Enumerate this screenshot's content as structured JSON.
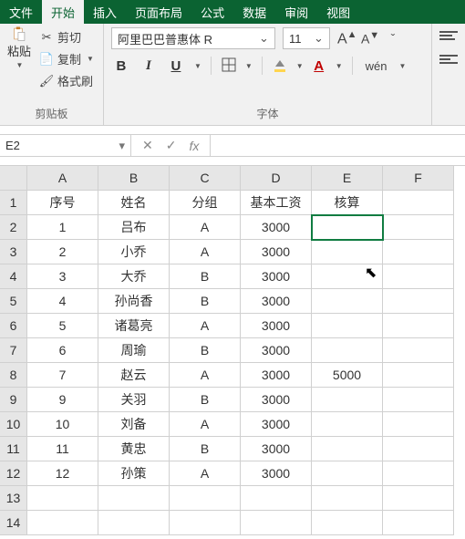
{
  "tabs": {
    "file": "文件",
    "home": "开始",
    "insert": "插入",
    "layout": "页面布局",
    "formula": "公式",
    "data": "数据",
    "review": "审阅",
    "view": "视图"
  },
  "clipboard": {
    "paste": "粘贴",
    "cut": "剪切",
    "copy": "复制",
    "format": "格式刷",
    "group_label": "剪贴板"
  },
  "font": {
    "name": "阿里巴巴普惠体 R",
    "size": "11",
    "bold": "B",
    "italic": "I",
    "underline": "U",
    "wen": "wén",
    "group_label": "字体"
  },
  "namebox": "E2",
  "formula_value": "",
  "columns": [
    "A",
    "B",
    "C",
    "D",
    "E",
    "F"
  ],
  "headers": [
    "序号",
    "姓名",
    "分组",
    "基本工资",
    "核算",
    ""
  ],
  "rows": [
    {
      "n": "1",
      "a": "1",
      "b": "吕布",
      "c": "A",
      "d": "3000",
      "e": "",
      "f": ""
    },
    {
      "n": "2",
      "a": "2",
      "b": "小乔",
      "c": "A",
      "d": "3000",
      "e": "",
      "f": ""
    },
    {
      "n": "3",
      "a": "3",
      "b": "大乔",
      "c": "B",
      "d": "3000",
      "e": "",
      "f": ""
    },
    {
      "n": "4",
      "a": "4",
      "b": "孙尚香",
      "c": "B",
      "d": "3000",
      "e": "",
      "f": ""
    },
    {
      "n": "5",
      "a": "5",
      "b": "诸葛亮",
      "c": "A",
      "d": "3000",
      "e": "",
      "f": ""
    },
    {
      "n": "6",
      "a": "6",
      "b": "周瑜",
      "c": "B",
      "d": "3000",
      "e": "",
      "f": ""
    },
    {
      "n": "7",
      "a": "7",
      "b": "赵云",
      "c": "A",
      "d": "3000",
      "e": "5000",
      "f": ""
    },
    {
      "n": "8",
      "a": "9",
      "b": "关羽",
      "c": "B",
      "d": "3000",
      "e": "",
      "f": ""
    },
    {
      "n": "9",
      "a": "10",
      "b": "刘备",
      "c": "A",
      "d": "3000",
      "e": "",
      "f": ""
    },
    {
      "n": "10",
      "a": "11",
      "b": "黄忠",
      "c": "B",
      "d": "3000",
      "e": "",
      "f": ""
    },
    {
      "n": "11",
      "a": "12",
      "b": "孙策",
      "c": "A",
      "d": "3000",
      "e": "",
      "f": ""
    },
    {
      "n": "12",
      "a": "",
      "b": "",
      "c": "",
      "d": "",
      "e": "",
      "f": ""
    },
    {
      "n": "13",
      "a": "",
      "b": "",
      "c": "",
      "d": "",
      "e": "",
      "f": ""
    }
  ],
  "chart_data": {
    "type": "table",
    "columns": [
      "序号",
      "姓名",
      "分组",
      "基本工资",
      "核算"
    ],
    "rows": [
      [
        1,
        "吕布",
        "A",
        3000,
        null
      ],
      [
        2,
        "小乔",
        "A",
        3000,
        null
      ],
      [
        3,
        "大乔",
        "B",
        3000,
        null
      ],
      [
        4,
        "孙尚香",
        "B",
        3000,
        null
      ],
      [
        5,
        "诸葛亮",
        "A",
        3000,
        null
      ],
      [
        6,
        "周瑜",
        "B",
        3000,
        null
      ],
      [
        7,
        "赵云",
        "A",
        3000,
        5000
      ],
      [
        9,
        "关羽",
        "B",
        3000,
        null
      ],
      [
        10,
        "刘备",
        "A",
        3000,
        null
      ],
      [
        11,
        "黄忠",
        "B",
        3000,
        null
      ],
      [
        12,
        "孙策",
        "A",
        3000,
        null
      ]
    ]
  }
}
